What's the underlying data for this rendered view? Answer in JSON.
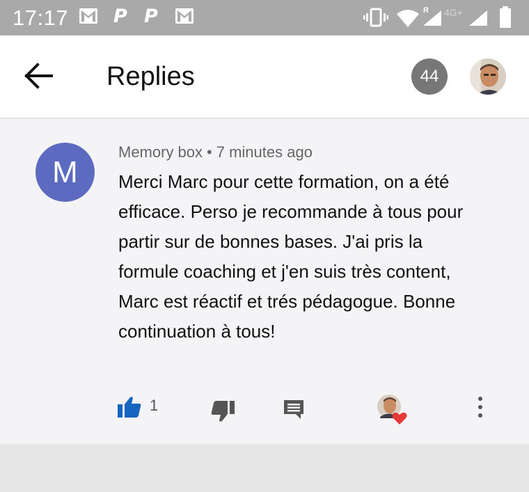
{
  "status_bar": {
    "time": "17:17",
    "network_label": "4G+",
    "roaming_label": "R",
    "paypal_glyph": "P",
    "icons": [
      "gmail-icon",
      "paypal-icon",
      "paypal-icon",
      "gmail-icon",
      "vibrate-icon",
      "wifi-icon",
      "signal-icon",
      "signal-icon",
      "battery-icon"
    ]
  },
  "header": {
    "title": "Replies",
    "back_icon": "arrow-left-icon",
    "count_badge": "44"
  },
  "comment": {
    "author_initial": "M",
    "author_avatar_color": "#5c6bc0",
    "author": "Memory box",
    "separator": "•",
    "time": "7 minutes ago",
    "text": "Merci Marc pour cette formation, on a été efficace. Perso je recommande à tous pour partir sur de bonnes bases. J'ai pris la formule coaching et j'en suis très content, Marc est réactif et trés pédagogue. Bonne continuation à tous!",
    "like_count": "1",
    "like_color": "#1565c0",
    "heart_color": "#e53935"
  }
}
